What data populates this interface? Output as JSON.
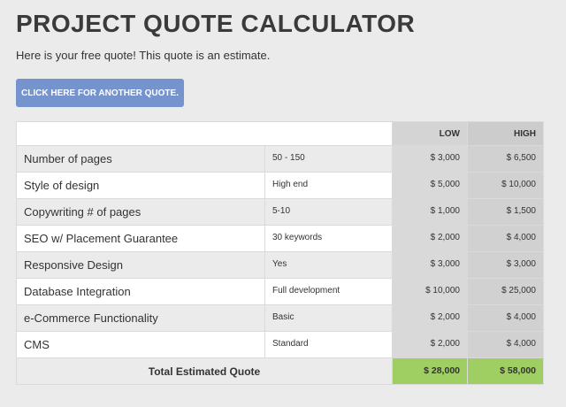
{
  "header": {
    "title": "PROJECT QUOTE CALCULATOR",
    "subtitle": "Here is your free quote! This quote is an estimate.",
    "button_label": "CLICK HERE FOR ANOTHER QUOTE."
  },
  "table": {
    "columns": {
      "low": "LOW",
      "high": "HIGH"
    },
    "rows": [
      {
        "item": "Number of pages",
        "detail": "50 - 150",
        "low": "$ 3,000",
        "high": "$ 6,500"
      },
      {
        "item": "Style of design",
        "detail": "High end",
        "low": "$ 5,000",
        "high": "$ 10,000"
      },
      {
        "item": "Copywriting # of pages",
        "detail": "5-10",
        "low": "$ 1,000",
        "high": "$ 1,500"
      },
      {
        "item": "SEO w/ Placement Guarantee",
        "detail": "30 keywords",
        "low": "$ 2,000",
        "high": "$ 4,000"
      },
      {
        "item": "Responsive Design",
        "detail": "Yes",
        "low": "$ 3,000",
        "high": "$ 3,000"
      },
      {
        "item": "Database Integration",
        "detail": "Full development",
        "low": "$ 10,000",
        "high": "$ 25,000"
      },
      {
        "item": "e-Commerce Functionality",
        "detail": "Basic",
        "low": "$ 2,000",
        "high": "$ 4,000"
      },
      {
        "item": "CMS",
        "detail": "Standard",
        "low": "$ 2,000",
        "high": "$ 4,000"
      }
    ],
    "total": {
      "label": "Total Estimated Quote",
      "low": "$ 28,000",
      "high": "$ 58,000"
    }
  },
  "colors": {
    "button": "#7593cc",
    "total_highlight": "#9fce62",
    "page_background": "#ebebeb"
  }
}
